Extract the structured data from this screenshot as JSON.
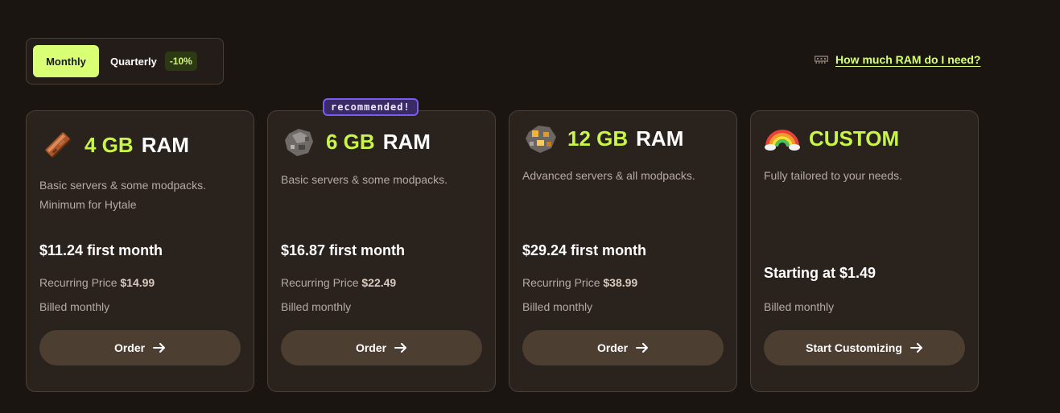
{
  "billing": {
    "monthly_label": "Monthly",
    "quarterly_label": "Quarterly",
    "quarterly_discount": "-10%",
    "selected": "Monthly"
  },
  "ram_help": {
    "label": "How much RAM do I need?",
    "icon": "ram-stick-icon"
  },
  "badge": "recommended!",
  "accent_color": "#c8f547",
  "plans": [
    {
      "icon": "copper-ingot-icon",
      "size": "4 GB",
      "suffix": "RAM",
      "description": "Basic servers & some modpacks. Minimum for Hytale",
      "first_month": "$11.24 first month",
      "recurring_label": "Recurring Price",
      "recurring_price": "$14.99",
      "billed": "Billed monthly",
      "button": "Order"
    },
    {
      "icon": "iron-ore-icon",
      "size": "6 GB",
      "suffix": "RAM",
      "description": "Basic servers & some modpacks.",
      "first_month": "$16.87 first month",
      "recurring_label": "Recurring Price",
      "recurring_price": "$22.49",
      "billed": "Billed monthly",
      "button": "Order"
    },
    {
      "icon": "gold-ore-icon",
      "size": "12 GB",
      "suffix": "RAM",
      "description": "Advanced servers & all modpacks.",
      "first_month": "$29.24 first month",
      "recurring_label": "Recurring Price",
      "recurring_price": "$38.99",
      "billed": "Billed monthly",
      "button": "Order"
    },
    {
      "icon": "rainbow-icon",
      "size": "CUSTOM",
      "description": "Fully tailored to your needs.",
      "starting": "Starting at $1.49",
      "billed": "Billed monthly",
      "button": "Start Customizing"
    }
  ]
}
